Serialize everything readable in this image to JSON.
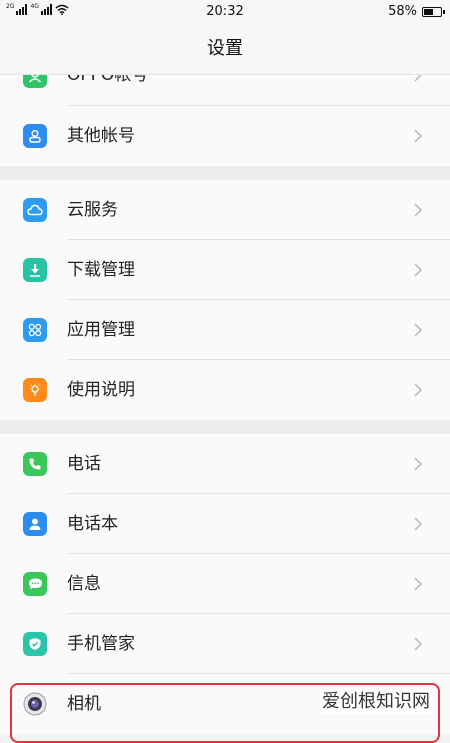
{
  "status_bar": {
    "signal1_tag": "2G",
    "signal2_tag": "4G",
    "time": "20:32",
    "battery": "58%",
    "battery_level": 0.58
  },
  "header": {
    "title": "设置"
  },
  "groups": [
    {
      "items": [
        {
          "label": "OPPO帐号",
          "icon": "account-icon",
          "color": "#2fc46a"
        },
        {
          "label": "其他帐号",
          "icon": "person-icon",
          "color": "#2d8cf0"
        }
      ]
    },
    {
      "items": [
        {
          "label": "云服务",
          "icon": "cloud-icon",
          "color": "#2d9cf0"
        },
        {
          "label": "下载管理",
          "icon": "download-icon",
          "color": "#27c3a4"
        },
        {
          "label": "应用管理",
          "icon": "apps-icon",
          "color": "#2d9cf0"
        },
        {
          "label": "使用说明",
          "icon": "lightbulb-icon",
          "color": "#ff8a1c"
        }
      ]
    },
    {
      "items": [
        {
          "label": "电话",
          "icon": "phone-icon",
          "color": "#3bc65a"
        },
        {
          "label": "电话本",
          "icon": "contacts-icon",
          "color": "#2d8cf0"
        },
        {
          "label": "信息",
          "icon": "message-icon",
          "color": "#3bc65a"
        },
        {
          "label": "手机管家",
          "icon": "shield-icon",
          "color": "#2cc4a8"
        },
        {
          "label": "相机",
          "icon": "camera-icon",
          "color": "#555555"
        }
      ]
    }
  ],
  "watermark": "爱创根知识网"
}
